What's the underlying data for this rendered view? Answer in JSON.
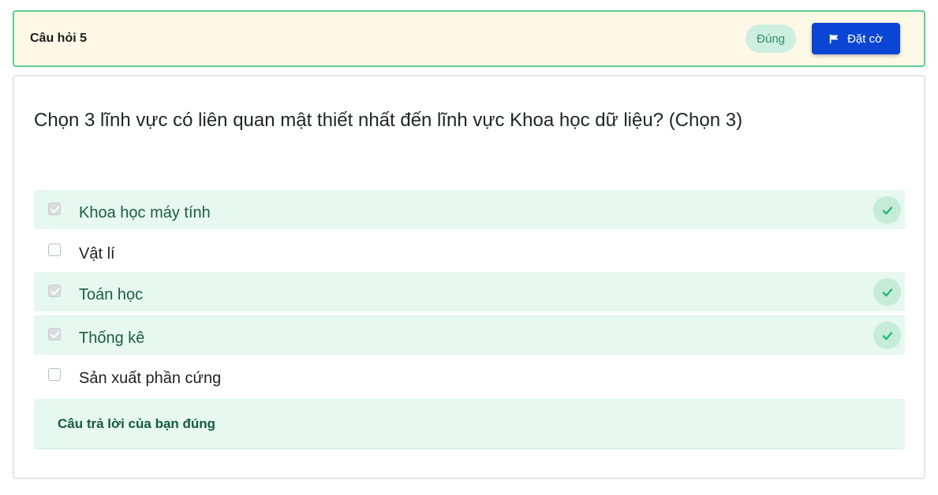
{
  "header": {
    "title": "Câu hỏi 5",
    "status": "Đúng",
    "flag_label": "Đặt cờ"
  },
  "question": {
    "text": "Chọn 3 lĩnh vực có liên quan mật thiết nhất đến lĩnh vực Khoa học dữ liệu? (Chọn 3)",
    "options": [
      {
        "label": "Khoa học máy tính",
        "checked": true,
        "correct": true
      },
      {
        "label": "Vật lí",
        "checked": false,
        "correct": false
      },
      {
        "label": "Toán học",
        "checked": true,
        "correct": true
      },
      {
        "label": "Thống kê",
        "checked": true,
        "correct": true
      },
      {
        "label": "Sản xuất phần cứng",
        "checked": false,
        "correct": false
      }
    ]
  },
  "feedback": {
    "text": "Câu trả lời của bạn đúng"
  },
  "colors": {
    "accent": "#0a46d3",
    "success": "#2ab673",
    "header_bg": "#fff8e6",
    "correct_bg": "#e6f8ef"
  }
}
